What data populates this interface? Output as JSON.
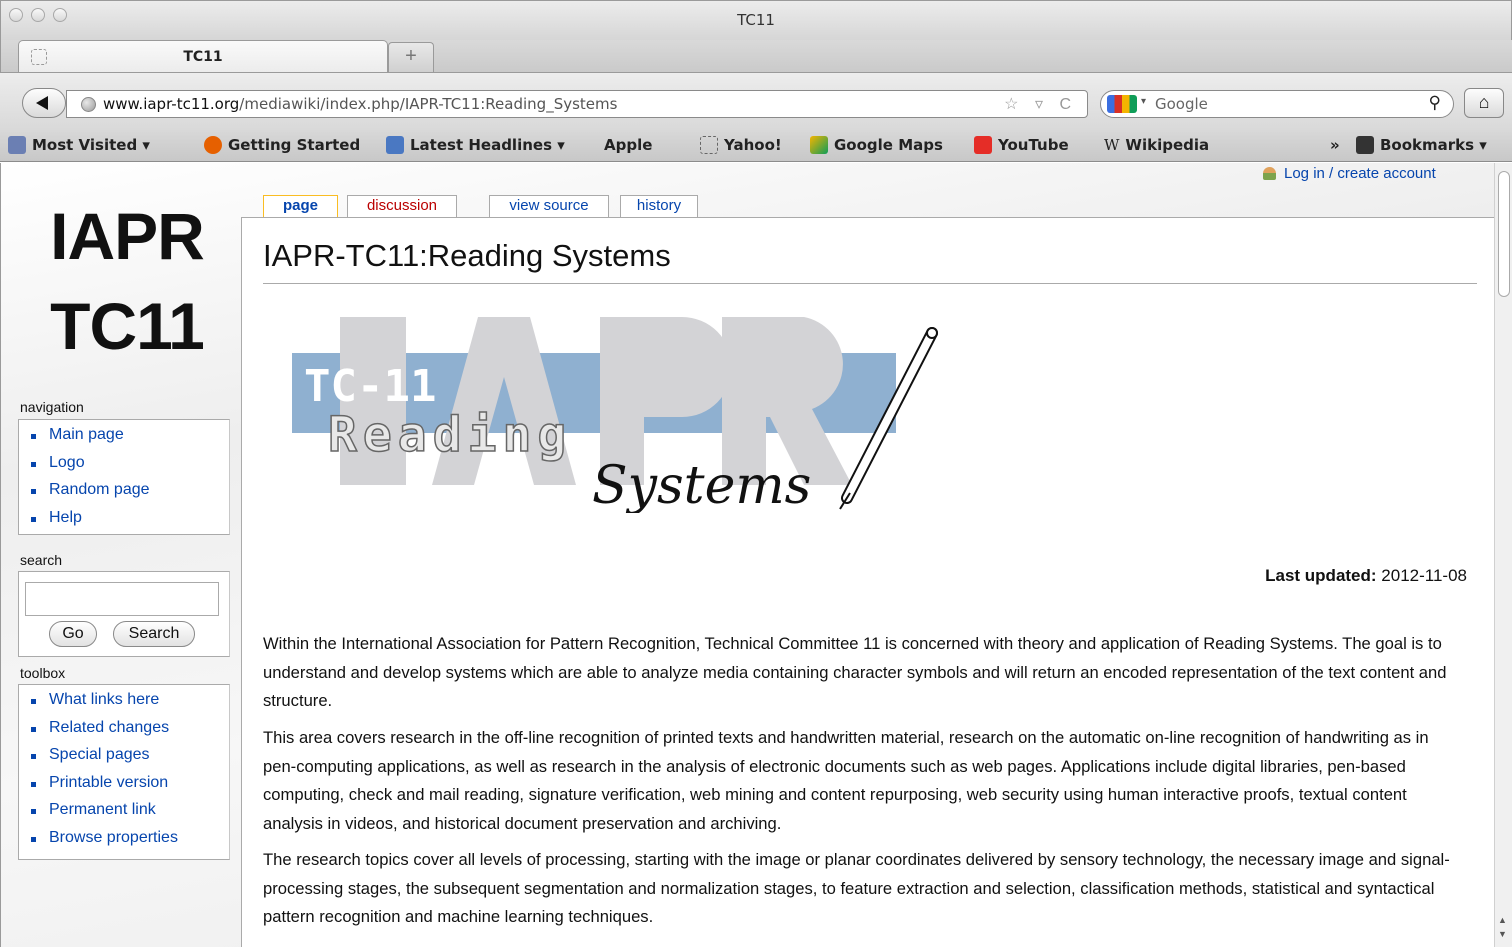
{
  "window": {
    "title": "TC11"
  },
  "tab": {
    "title": "TC11",
    "new_tab_label": "+"
  },
  "navbar": {
    "url_host": "www.iapr-tc11.org",
    "url_path": "/mediawiki/index.php/IAPR-TC11:Reading_Systems",
    "url_icons": "☆ ▿ C",
    "search_placeholder": "Google",
    "search_icon": "magnifier-icon",
    "home_icon": "home-icon"
  },
  "bookmarks": [
    {
      "label": "Most Visited ▾",
      "icon": "folder-icon",
      "color": "#6b7fb3"
    },
    {
      "label": "Getting Started",
      "icon": "firefox-icon",
      "color": "#e66000"
    },
    {
      "label": "Latest Headlines ▾",
      "icon": "rss-icon",
      "color": "#4a78c2"
    },
    {
      "label": "Apple",
      "icon": "apple-icon",
      "color": "#333333"
    },
    {
      "label": "Yahoo!",
      "icon": "page-icon",
      "color": "#ffffff"
    },
    {
      "label": "Google Maps",
      "icon": "maps-icon",
      "color": "#f4b400"
    },
    {
      "label": "YouTube",
      "icon": "youtube-icon",
      "color": "#e52d27"
    },
    {
      "label": "Wikipedia",
      "icon": "wikipedia-icon",
      "color": "#ffffff"
    }
  ],
  "bookmarks_overflow": "»",
  "bookmarks_menu": "Bookmarks ▾",
  "wiki": {
    "logo_line1": "IAPR",
    "logo_line2": "TC11",
    "login_text": "Log in / create account",
    "tabs": [
      "page",
      "discussion",
      "view source",
      "history"
    ],
    "heading": "IAPR-TC11:Reading Systems",
    "banner": {
      "text_tc": "TC-11",
      "text_reading": "Reading",
      "text_systems": "Systems",
      "bg_text": "IAPR",
      "colors": {
        "blue": "#8fb0d0",
        "gray": "#d3d3d6"
      }
    },
    "last_updated_label": "Last updated:",
    "last_updated_value": "2012-11-08",
    "paragraphs": [
      "Within the International Association for Pattern Recognition, Technical Committee 11 is concerned with theory and application of Reading Systems. The goal is to understand and develop systems which are able to analyze media containing character symbols and will return an encoded representation of the text content and structure.",
      "This area covers research in the off-line recognition of printed texts and handwritten material, research on the automatic on-line recognition of handwriting as in pen-computing applications, as well as research in the analysis of electronic documents such as web pages. Applications include digital libraries, pen-based computing, check and mail reading, signature verification, web mining and content repurposing, web security using human interactive proofs, textual content analysis in videos, and historical document preservation and archiving.",
      "The research topics cover all levels of processing, starting with the image or planar coordinates delivered by sensory technology, the necessary image and signal-processing stages, the subsequent segmentation and normalization stages, to feature extraction and selection, classification methods, statistical and syntactical pattern recognition and machine learning techniques."
    ],
    "navigation": {
      "heading": "navigation",
      "items": [
        "Main page",
        "Logo",
        "Random page",
        "Help"
      ]
    },
    "search": {
      "heading": "search",
      "go_label": "Go",
      "search_label": "Search",
      "value": ""
    },
    "toolbox": {
      "heading": "toolbox",
      "items": [
        "What links here",
        "Related changes",
        "Special pages",
        "Printable version",
        "Permanent link",
        "Browse properties"
      ]
    },
    "link_color": "#0645ad",
    "newlink_color": "#ba0000"
  }
}
